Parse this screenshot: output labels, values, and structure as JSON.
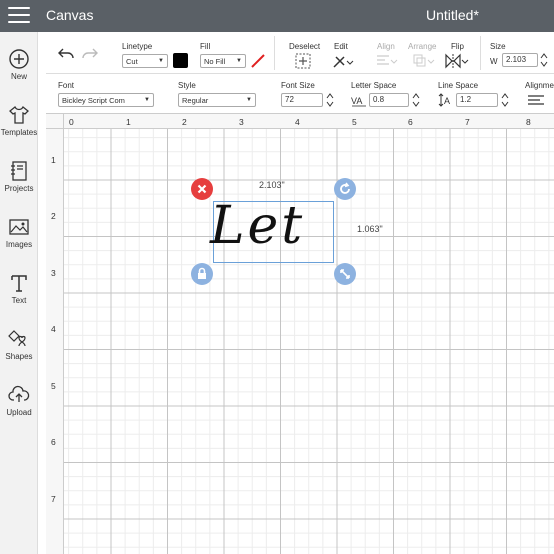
{
  "header": {
    "app_title": "Canvas",
    "doc_title": "Untitled*"
  },
  "sidebar": {
    "items": [
      {
        "label": "New",
        "icon": "plus-circle-icon"
      },
      {
        "label": "Templates",
        "icon": "shirt-icon"
      },
      {
        "label": "Projects",
        "icon": "notebook-icon"
      },
      {
        "label": "Images",
        "icon": "image-icon"
      },
      {
        "label": "Text",
        "icon": "text-t-icon"
      },
      {
        "label": "Shapes",
        "icon": "shapes-icon"
      },
      {
        "label": "Upload",
        "icon": "cloud-upload-icon"
      }
    ]
  },
  "toolbar1": {
    "linetype_label": "Linetype",
    "linetype_value": "Cut",
    "linetype_color": "#000000",
    "fill_label": "Fill",
    "fill_value": "No Fill",
    "deselect_label": "Deselect",
    "edit_label": "Edit",
    "align_label": "Align",
    "arrange_label": "Arrange",
    "flip_label": "Flip",
    "size_label": "Size",
    "size_w_label": "W",
    "size_w_value": "2.103"
  },
  "toolbar2": {
    "font_label": "Font",
    "font_value": "Bickley Script Com",
    "style_label": "Style",
    "style_value": "Regular",
    "font_size_label": "Font Size",
    "font_size_value": "72",
    "letter_space_label": "Letter Space",
    "letter_space_value": "0.8",
    "line_space_label": "Line Space",
    "line_space_value": "1.2",
    "alignment_label": "Alignme"
  },
  "canvas": {
    "ruler_x": [
      "0",
      "1",
      "2",
      "3",
      "4",
      "5",
      "6",
      "7",
      "8"
    ],
    "ruler_y": [
      "1",
      "2",
      "3",
      "4",
      "5",
      "6",
      "7"
    ],
    "text_object": "Let",
    "width_label": "2.103\"",
    "height_label": "1.063\""
  },
  "colors": {
    "topbar": "#5a6066",
    "accent_red": "#e63e3e",
    "handle_blue": "#8db2e0",
    "selection": "#6aa0d8"
  }
}
